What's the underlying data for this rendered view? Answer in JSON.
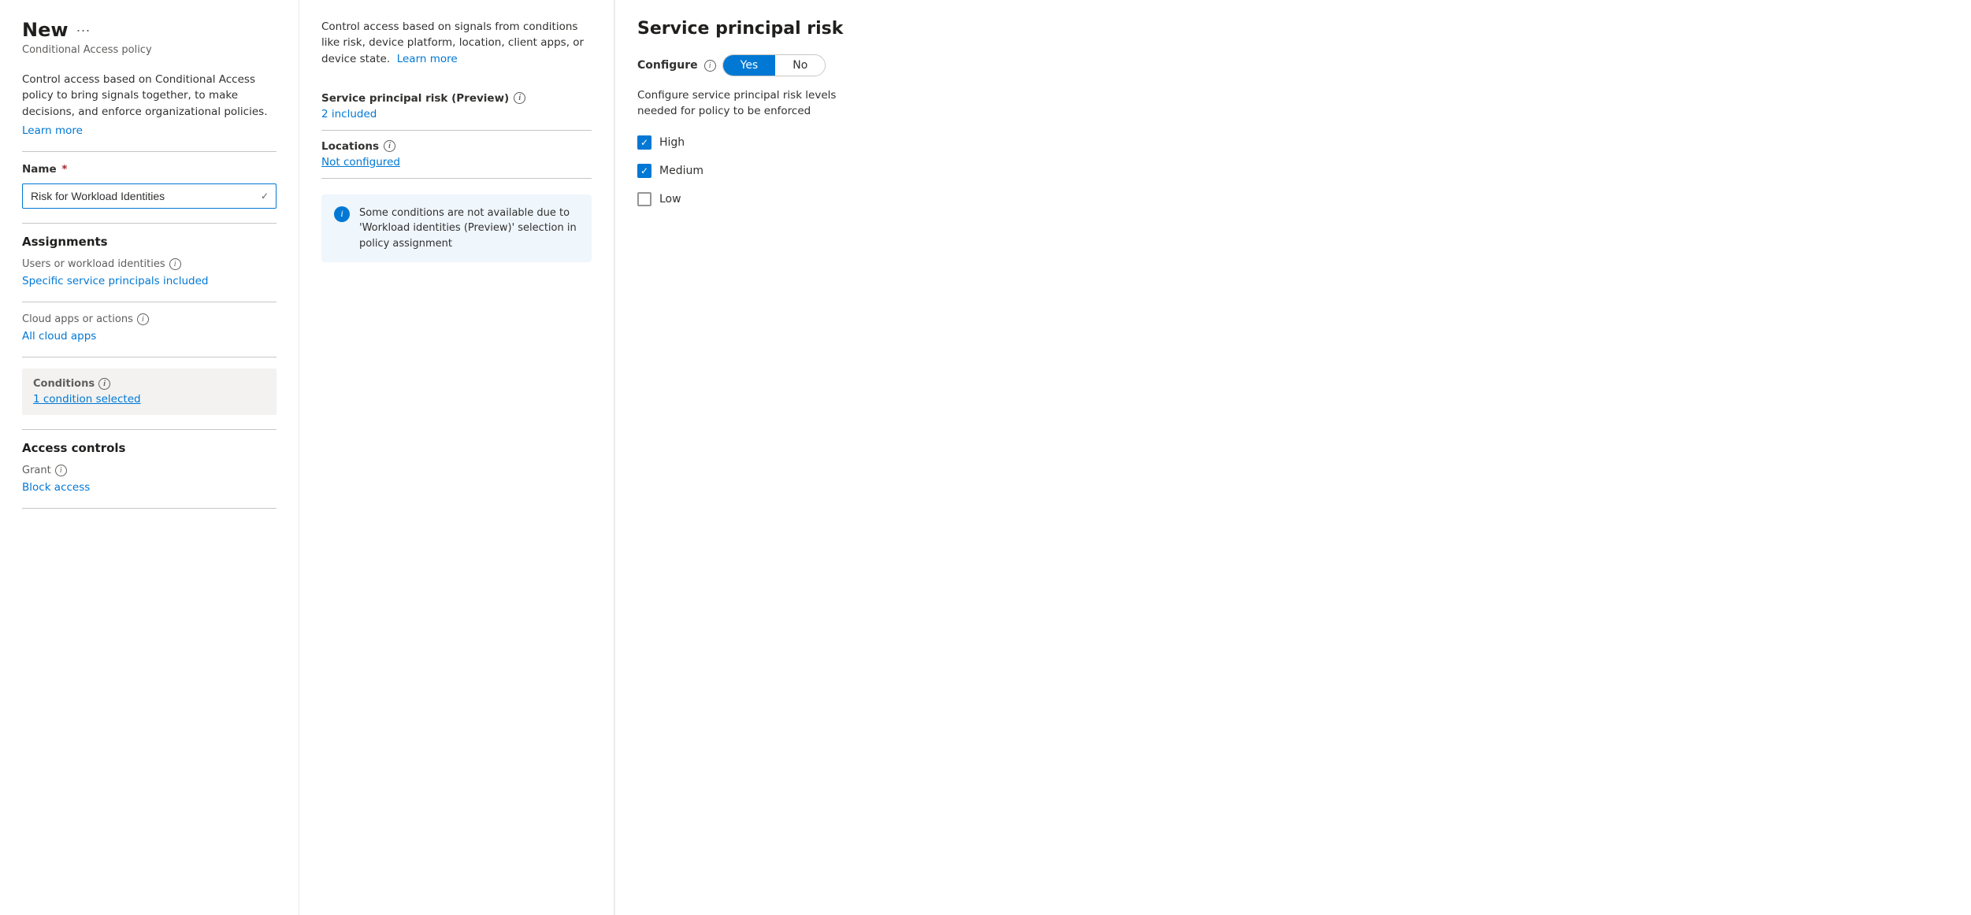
{
  "page": {
    "title": "New",
    "subtitle": "Conditional Access policy",
    "more_options_label": "···"
  },
  "left": {
    "description": "Control access based on Conditional Access policy to bring signals together, to make decisions, and enforce organizational policies.",
    "learn_more": "Learn more",
    "name_label": "Name",
    "name_value": "Risk for Workload Identities",
    "assignments_label": "Assignments",
    "users_label": "Users or workload identities",
    "users_value": "Specific service principals included",
    "cloud_apps_label": "Cloud apps or actions",
    "cloud_apps_value": "All cloud apps",
    "conditions_label": "Conditions",
    "conditions_value": "1 condition selected",
    "access_controls_label": "Access controls",
    "grant_label": "Grant",
    "grant_value": "Block access"
  },
  "middle": {
    "description": "Control access based on signals from conditions like risk, device platform, location, client apps, or device state.",
    "learn_more": "Learn more",
    "service_principal_risk_label": "Service principal risk (Preview)",
    "service_principal_risk_value": "2 included",
    "locations_label": "Locations",
    "locations_value": "Not configured",
    "info_box_text": "Some conditions are not available due to 'Workload identities (Preview)' selection in policy assignment"
  },
  "right": {
    "panel_title": "Service principal risk",
    "configure_label": "Configure",
    "yes_label": "Yes",
    "no_label": "No",
    "configure_description": "Configure service principal risk levels needed for policy to be enforced",
    "checkboxes": [
      {
        "label": "High",
        "checked": true
      },
      {
        "label": "Medium",
        "checked": true
      },
      {
        "label": "Low",
        "checked": false
      }
    ]
  }
}
